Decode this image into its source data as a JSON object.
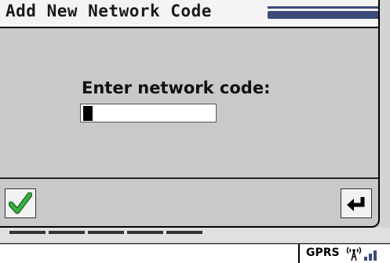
{
  "dialog": {
    "title": "Add New Network Code",
    "prompt": "Enter network code:",
    "input_value": "",
    "ok_button_icon": "checkmark-icon",
    "back_button_icon": "return-arrow-icon"
  },
  "status": {
    "connection": "GPRS",
    "signal_icon": "antenna-signal-icon"
  },
  "colors": {
    "title_stripe": "#3b4b7a",
    "checkmark": "#3cb043",
    "dialog_bg": "#c9c9c9"
  }
}
